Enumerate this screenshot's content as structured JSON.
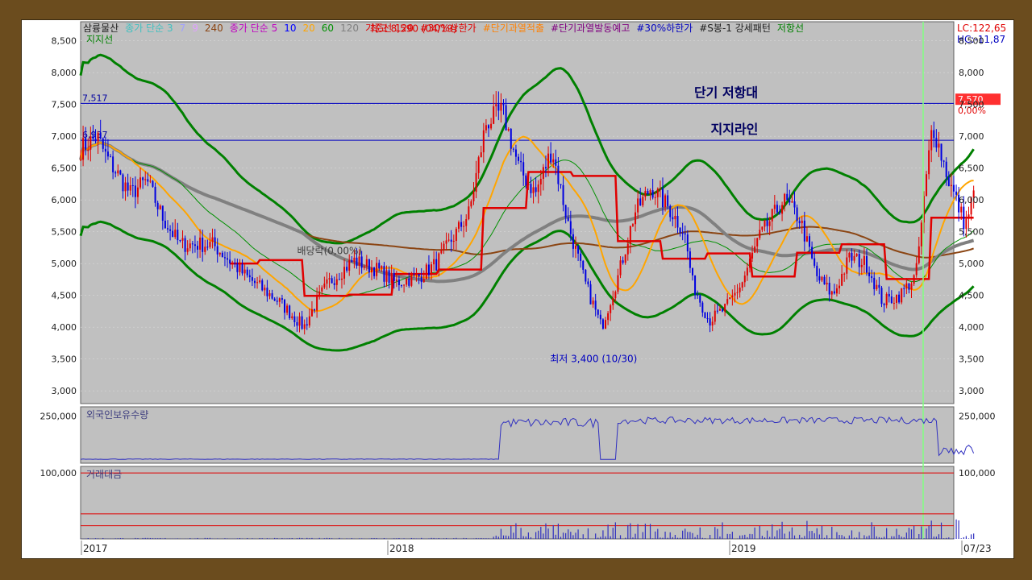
{
  "legend": {
    "line1": [
      {
        "text": "삼륭물산",
        "color": "#202020"
      },
      {
        "text": "종가 단순 3",
        "color": "#40c0c0"
      },
      {
        "text": "7",
        "color": "#a0a0ff"
      },
      {
        "text": "9",
        "color": "#e0a0ff"
      },
      {
        "text": "240",
        "color": "#8b4513"
      },
      {
        "text": "종가 단순 5",
        "color": "#c000c0"
      },
      {
        "text": "10",
        "color": "#0000ff"
      },
      {
        "text": "20",
        "color": "#ffa500"
      },
      {
        "text": "60",
        "color": "#009000"
      },
      {
        "text": "120",
        "color": "#808080"
      },
      {
        "text": "기준선 120",
        "color": "#e00000"
      },
      {
        "text": "#30%상한가",
        "color": "#e00000"
      },
      {
        "text": "#단기과열적출",
        "color": "#ff8000"
      },
      {
        "text": "#단기과열발동예고",
        "color": "#800080"
      },
      {
        "text": "#30%하한가",
        "color": "#0000c0"
      },
      {
        "text": "#S봉-1 강세패턴",
        "color": "#202020"
      },
      {
        "text": "저항선",
        "color": "#008000"
      }
    ],
    "line2": {
      "text": "지지선",
      "color": "#008000"
    },
    "lc": "LC:122,65",
    "hc": "HC:-11,87"
  },
  "chart_data": [
    {
      "type": "candlestick",
      "name": "price",
      "ylim": [
        2800,
        8800
      ],
      "yticks": [
        "3,000",
        "3,500",
        "4,000",
        "4,500",
        "5,000",
        "5,500",
        "6,000",
        "6,500",
        "7,000",
        "7,500",
        "8,000",
        "8,500"
      ],
      "ytick_values": [
        3000,
        3500,
        4000,
        4500,
        5000,
        5500,
        6000,
        6500,
        7000,
        7500,
        8000,
        8500
      ],
      "x_labels": [
        "2017",
        "2018",
        "2019",
        "07/23"
      ],
      "current_price": "7,570",
      "current_change": "0,00%",
      "current_price_value": 7570,
      "hlines": [
        {
          "value": 7517,
          "label": "7,517"
        },
        {
          "value": 6937,
          "label": "6,937"
        }
      ],
      "annotations": [
        {
          "text": "최고 8,590 (04/19)",
          "color": "#e00000",
          "x": 0.397,
          "y": 8590
        },
        {
          "text": "최저 3,400 (10/30)",
          "color": "#0000c0",
          "x": 0.612,
          "y": 3400
        },
        {
          "text": "배당락(0,00%)",
          "color": "#404040",
          "x": 0.297,
          "y": 5100
        },
        {
          "text": "단기 저항대",
          "color": "#000060",
          "x": 0.77,
          "y": 7517
        },
        {
          "text": "지지라인",
          "color": "#000060",
          "x": 0.78,
          "y": 6937
        }
      ],
      "close_anchors": [
        [
          0,
          6800
        ],
        [
          0.02,
          7000
        ],
        [
          0.03,
          6700
        ],
        [
          0.06,
          6100
        ],
        [
          0.08,
          6300
        ],
        [
          0.1,
          5700
        ],
        [
          0.12,
          5300
        ],
        [
          0.16,
          5300
        ],
        [
          0.2,
          4800
        ],
        [
          0.24,
          4400
        ],
        [
          0.27,
          4000
        ],
        [
          0.285,
          4400
        ],
        [
          0.3,
          4700
        ],
        [
          0.33,
          5050
        ],
        [
          0.36,
          4900
        ],
        [
          0.38,
          4700
        ],
        [
          0.41,
          4800
        ],
        [
          0.43,
          5000
        ],
        [
          0.45,
          5400
        ],
        [
          0.47,
          5800
        ],
        [
          0.49,
          7200
        ],
        [
          0.51,
          7400
        ],
        [
          0.53,
          6500
        ],
        [
          0.55,
          6100
        ],
        [
          0.57,
          6800
        ],
        [
          0.59,
          5600
        ],
        [
          0.61,
          4700
        ],
        [
          0.63,
          4000
        ],
        [
          0.65,
          4800
        ],
        [
          0.67,
          5800
        ],
        [
          0.69,
          6200
        ],
        [
          0.71,
          5900
        ],
        [
          0.73,
          5500
        ],
        [
          0.74,
          4700
        ],
        [
          0.76,
          4100
        ],
        [
          0.78,
          4300
        ],
        [
          0.8,
          4700
        ],
        [
          0.82,
          5400
        ],
        [
          0.85,
          6000
        ],
        [
          0.87,
          5700
        ],
        [
          0.89,
          4800
        ],
        [
          0.91,
          4500
        ],
        [
          0.93,
          5100
        ],
        [
          0.95,
          5000
        ],
        [
          0.97,
          4400
        ],
        [
          0.99,
          4500
        ],
        [
          1.01,
          4800
        ],
        [
          1.03,
          7200
        ],
        [
          1.05,
          6300
        ],
        [
          1.07,
          5600
        ],
        [
          1.08,
          6100
        ]
      ]
    },
    {
      "type": "line",
      "name": "외국인보유수량",
      "ylim": [
        0,
        300000
      ],
      "yticks": [
        "250,000"
      ],
      "ytick_values": [
        250000
      ]
    },
    {
      "type": "bar",
      "name": "거래대금",
      "ylim": [
        0,
        110000
      ],
      "yticks": [
        "100,000"
      ],
      "ytick_values": [
        100000
      ],
      "hlines": [
        100000,
        38000,
        20000
      ]
    }
  ]
}
